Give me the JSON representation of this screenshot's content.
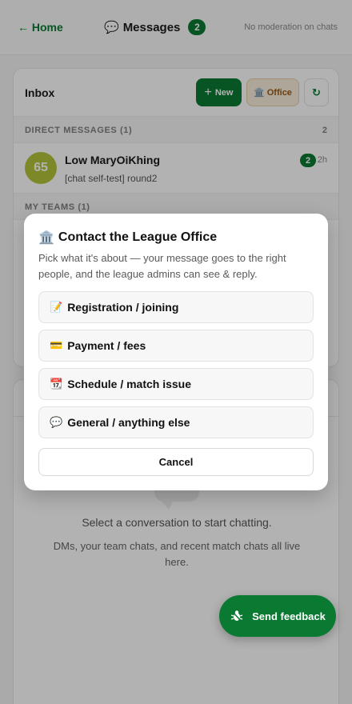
{
  "header": {
    "back_label": "← Home",
    "title_icon": "💬",
    "title": "Messages",
    "badge": "2",
    "note": "No moderation on chats"
  },
  "inbox": {
    "title": "Inbox",
    "new_label": "New",
    "new_icon": "+",
    "office_icon": "🏛️",
    "office_label": "Office",
    "refresh_icon": "↻",
    "direct_messages_label": "DIRECT MESSAGES (1)",
    "direct_messages_count": "2",
    "dm": {
      "avatar_text": "65",
      "name": "Low MaryOiKhing",
      "preview": "[chat self-test] round2",
      "unread": "2",
      "time": "2h"
    },
    "my_teams_label": "MY TEAMS (1)"
  },
  "chat_pane": {
    "empty_title": "Select a conversation to start chatting.",
    "empty_subtitle": "DMs, your team chats, and recent match chats all live here."
  },
  "feedback": {
    "label": "Send feedback",
    "icon": "bug-icon"
  },
  "modal": {
    "title_icon": "🏛️",
    "title": "Contact the League Office",
    "description": "Pick what it's about — your message goes to the right people, and the league admins can see & reply.",
    "options": [
      {
        "icon": "📝",
        "label": "Registration / joining"
      },
      {
        "icon": "💳",
        "label": "Payment / fees"
      },
      {
        "icon": "📆",
        "label": "Schedule / match issue"
      },
      {
        "icon": "💬",
        "label": "General / anything else"
      }
    ],
    "cancel_label": "Cancel"
  },
  "colors": {
    "accent": "#0a7a32",
    "office_bg": "#fbeedd",
    "office_text": "#9a5a10",
    "avatar_bg": "#b4c43c"
  }
}
